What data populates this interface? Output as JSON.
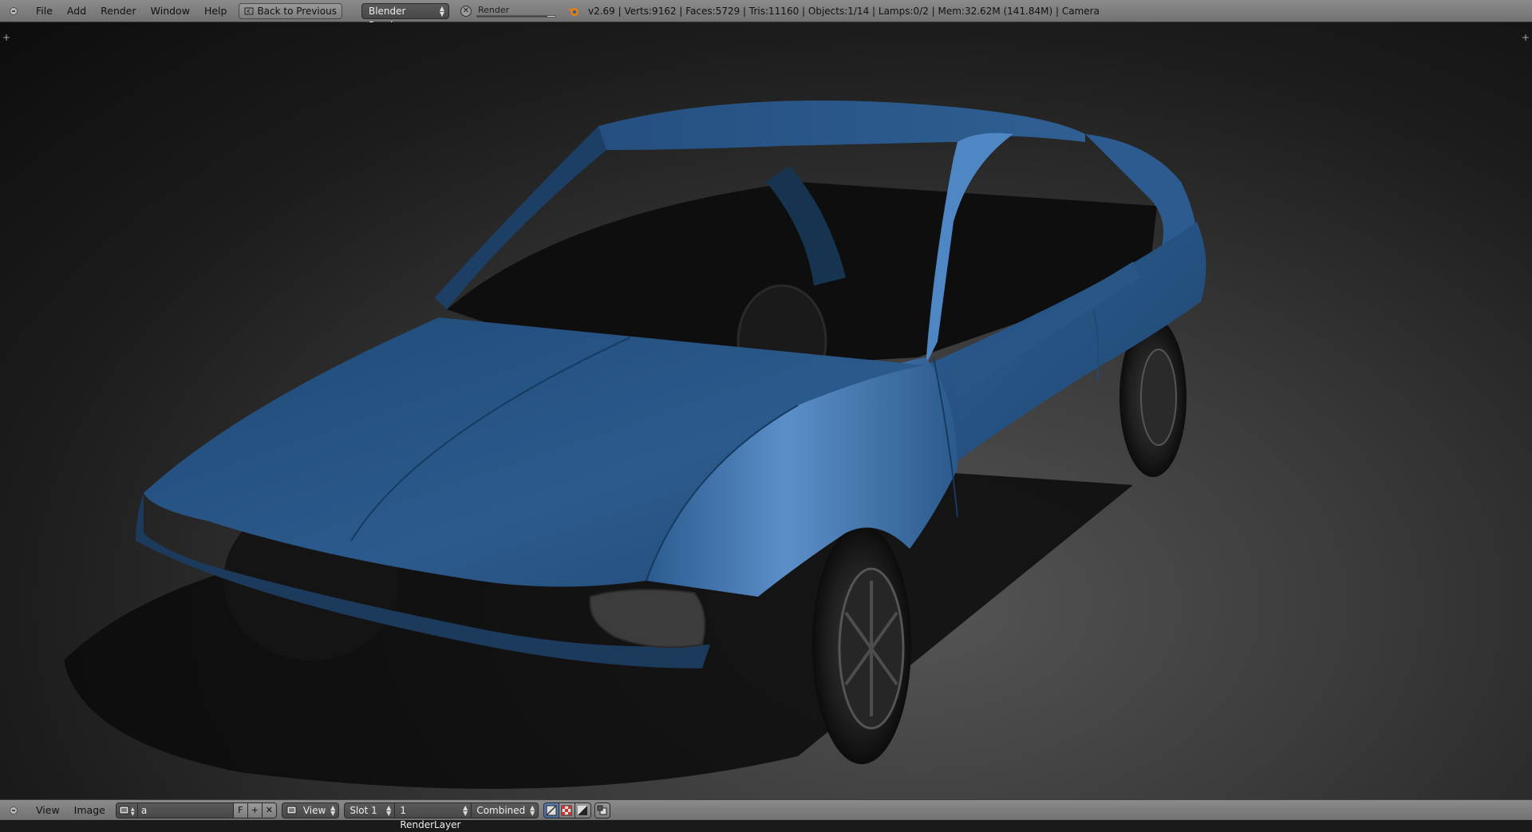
{
  "topbar": {
    "menus": [
      "File",
      "Add",
      "Render",
      "Window",
      "Help"
    ],
    "back_button": "Back to Previous",
    "engine": "Blender Render",
    "render_label": "Render",
    "render_progress": 0.9,
    "stats": "v2.69 | Verts:9162 | Faces:5729 | Tris:11160 | Objects:1/14 | Lamps:0/2 | Mem:32.62M (141.84M) | Camera"
  },
  "bottombar": {
    "menus": [
      "View",
      "Image"
    ],
    "image_name": "a",
    "fake_user": "F",
    "view_mode": "View",
    "slot": "Slot 1",
    "render_layer": "1 RenderLayer",
    "pass": "Combined"
  },
  "colors": {
    "car_body": "#2c5a8c",
    "header": "#7f7f7f",
    "toggle_active": "#5a7fb5"
  }
}
